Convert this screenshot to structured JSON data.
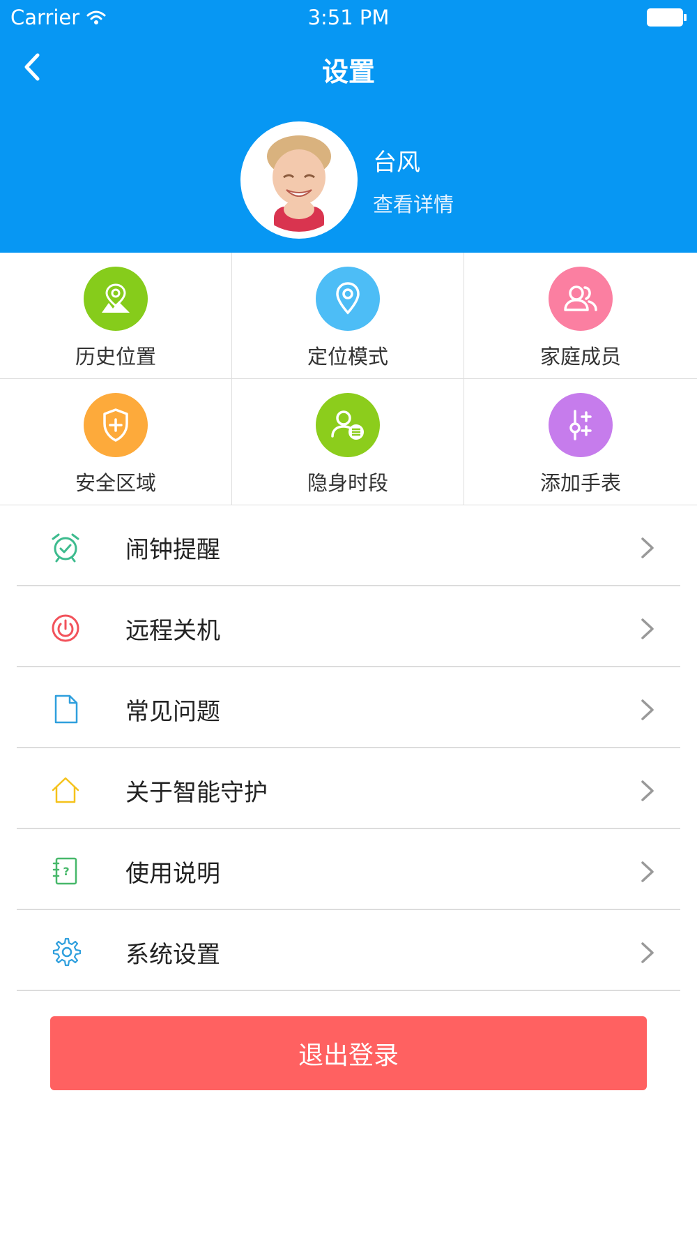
{
  "status_bar": {
    "carrier": "Carrier",
    "time": "3:51 PM",
    "wifi_icon": "wifi-icon",
    "battery_icon": "battery-icon"
  },
  "nav": {
    "title": "设置",
    "back_icon": "chevron-left-icon"
  },
  "profile": {
    "name": "台风",
    "detail": "查看详情"
  },
  "grid": [
    {
      "label": "历史位置",
      "icon": "location-map-icon",
      "color": "#86cc1b"
    },
    {
      "label": "定位模式",
      "icon": "map-pin-icon",
      "color": "#4dbdf6"
    },
    {
      "label": "家庭成员",
      "icon": "users-icon",
      "color": "#fb7fa1"
    },
    {
      "label": "安全区域",
      "icon": "shield-plus-icon",
      "color": "#fdaa3b"
    },
    {
      "label": "隐身时段",
      "icon": "user-list-icon",
      "color": "#8ccd1c"
    },
    {
      "label": "添加手表",
      "icon": "sliders-plus-icon",
      "color": "#c67cec"
    }
  ],
  "list": [
    {
      "label": "闹钟提醒",
      "icon": "alarm-clock-icon",
      "color": "#3dbb8e"
    },
    {
      "label": "远程关机",
      "icon": "power-icon",
      "color": "#f2525b"
    },
    {
      "label": "常见问题",
      "icon": "document-icon",
      "color": "#2f9fdd"
    },
    {
      "label": "关于智能守护",
      "icon": "home-icon",
      "color": "#f5c21b"
    },
    {
      "label": "使用说明",
      "icon": "help-book-icon",
      "color": "#47b86a"
    },
    {
      "label": "系统设置",
      "icon": "gear-icon",
      "color": "#2f9fdd"
    }
  ],
  "logout": {
    "label": "退出登录",
    "color": "#ff6161"
  },
  "colors": {
    "header": "#0797f3",
    "chevron": "#999999"
  }
}
